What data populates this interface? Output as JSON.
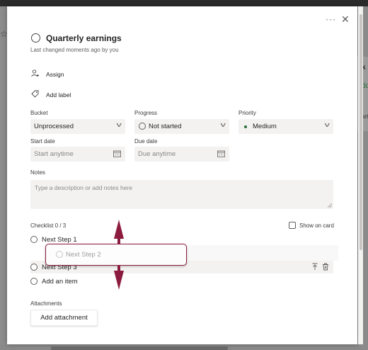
{
  "background": {
    "k_letter": "k",
    "k_partial": "dd",
    "card_text": "art"
  },
  "task": {
    "title": "Quarterly earnings",
    "last_changed": "Last changed moments ago by you"
  },
  "actions": {
    "assign": "Assign",
    "add_label": "Add label"
  },
  "fields": {
    "bucket": {
      "label": "Bucket",
      "value": "Unprocessed"
    },
    "progress": {
      "label": "Progress",
      "value": "Not started"
    },
    "priority": {
      "label": "Priority",
      "value": "Medium"
    },
    "start_date": {
      "label": "Start date",
      "placeholder": "Start anytime"
    },
    "due_date": {
      "label": "Due date",
      "placeholder": "Due anytime"
    }
  },
  "notes": {
    "label": "Notes",
    "placeholder": "Type a description or add notes here"
  },
  "checklist": {
    "header": "Checklist 0 / 3",
    "show_on_card": "Show on card",
    "items": [
      {
        "label": "Next Step 1"
      },
      {
        "label": "Next Step 3"
      }
    ],
    "dragging_item": "Next Step 2",
    "add_item": "Add an item"
  },
  "attachments": {
    "label": "Attachments",
    "button": "Add attachment"
  },
  "colors": {
    "accent_arrow": "#8c1c3f",
    "priority_dot": "#2b6f3a",
    "field_bg": "#f3f2f1"
  },
  "icons": {
    "more": "more-options-icon",
    "close": "close-icon",
    "assign": "person-add-icon",
    "label": "tag-icon",
    "calendar": "calendar-icon",
    "move_top": "move-to-top-icon",
    "delete": "trash-icon"
  }
}
